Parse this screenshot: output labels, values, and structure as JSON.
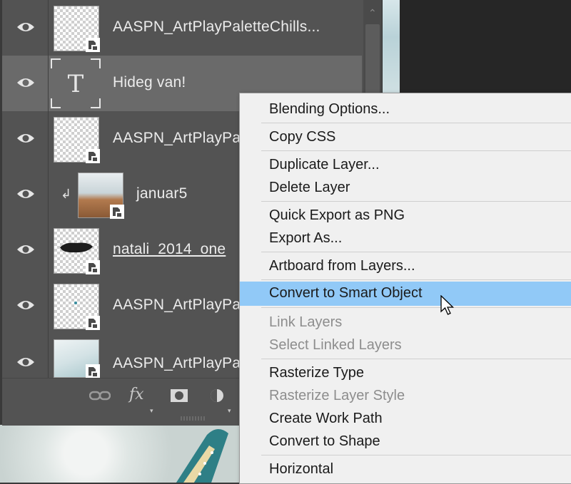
{
  "layers": [
    {
      "name": "AASPN_ArtPlayPaletteChills...",
      "visible": true,
      "type": "smart-object"
    },
    {
      "name": "Hideg van!",
      "visible": true,
      "type": "text",
      "selected": true
    },
    {
      "name": "AASPN_ArtPlayPa",
      "visible": true,
      "type": "smart-object"
    },
    {
      "name": "januar5",
      "visible": true,
      "type": "smart-object",
      "clipped": true
    },
    {
      "name": "natali_2014_one",
      "visible": true,
      "type": "smart-object"
    },
    {
      "name": "AASPN_ArtPlayPa",
      "visible": true,
      "type": "smart-object"
    },
    {
      "name": "AASPN_ArtPlayPa",
      "visible": true,
      "type": "smart-object"
    }
  ],
  "text_layer_glyph": "T",
  "footer": {
    "link_icon": "link-icon",
    "fx_label": "fx",
    "mask_icon": "mask-icon",
    "adjustment_icon": "adjustment-icon"
  },
  "menu": {
    "items": [
      {
        "label": "Blending Options..."
      },
      {
        "label": "Copy CSS"
      },
      {
        "label": "Duplicate Layer..."
      },
      {
        "label": "Delete Layer"
      },
      {
        "label": "Quick Export as PNG"
      },
      {
        "label": "Export As..."
      },
      {
        "label": "Artboard from Layers..."
      },
      {
        "label": "Convert to Smart Object",
        "highlighted": true
      },
      {
        "label": "Link Layers",
        "disabled": true
      },
      {
        "label": "Select Linked Layers",
        "disabled": true
      },
      {
        "label": "Rasterize Type"
      },
      {
        "label": "Rasterize Layer Style",
        "disabled": true
      },
      {
        "label": "Create Work Path"
      },
      {
        "label": "Convert to Shape"
      },
      {
        "label": "Horizontal"
      }
    ]
  },
  "colors": {
    "panel": "#535353",
    "selected_layer": "#6a6a6a",
    "menu_bg": "#f0f0f0",
    "menu_highlight": "#91c9f7",
    "disabled_text": "#8d8d8d"
  }
}
